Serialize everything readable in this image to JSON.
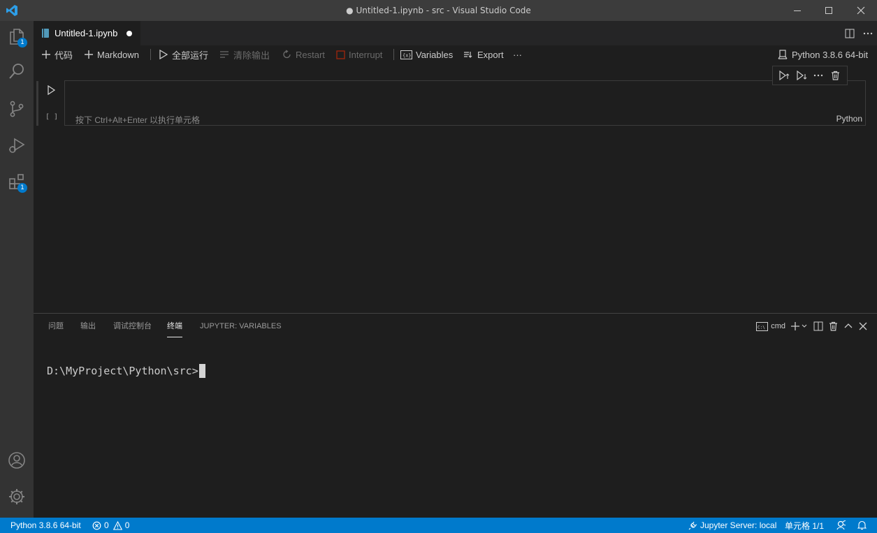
{
  "window": {
    "title": "● Untitled-1.ipynb - src - Visual Studio Code"
  },
  "activity": {
    "explorer_badge": "1",
    "extensions_badge": "1"
  },
  "tab": {
    "label": "Untitled-1.ipynb"
  },
  "toolbar": {
    "add_code": "代码",
    "add_markdown": "Markdown",
    "run_all": "全部运行",
    "clear_outputs": "清除输出",
    "restart": "Restart",
    "interrupt": "Interrupt",
    "variables": "Variables",
    "export": "Export",
    "more": "···",
    "kernel": "Python 3.8.6 64-bit"
  },
  "cell": {
    "exec_count": "[ ]",
    "placeholder": "按下 Ctrl+Alt+Enter 以执行单元格",
    "language": "Python"
  },
  "panel": {
    "tabs": [
      "问题",
      "输出",
      "调试控制台",
      "终端",
      "JUPYTER: VARIABLES"
    ],
    "active_tab": "终端",
    "terminal_type": "cmd",
    "prompt": "D:\\MyProject\\Python\\src>"
  },
  "statusbar": {
    "interpreter": "Python 3.8.6 64-bit",
    "errors": "0",
    "warnings": "0",
    "jupyter_server": "Jupyter Server: local",
    "cell_position": "单元格 1/1"
  },
  "colors": {
    "accent": "#007acc",
    "titlebar": "#3c3c3c",
    "activitybar": "#333333",
    "editor_bg": "#1e1e1e"
  }
}
